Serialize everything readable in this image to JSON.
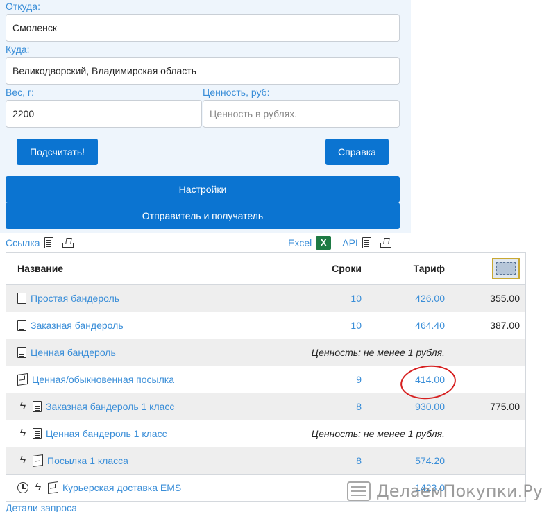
{
  "form": {
    "from_label": "Откуда:",
    "from_value": "Смоленск",
    "to_label": "Куда:",
    "to_value": "Великодворский, Владимирская область",
    "weight_label": "Вес, г:",
    "weight_value": "2200",
    "value_label": "Ценность, руб:",
    "value_placeholder": "Ценность в рублях.",
    "calc_button": "Подсчитать!",
    "help_button": "Справка",
    "settings_band": "Настройки",
    "sender_band": "Отправитель и получатель"
  },
  "toolbar": {
    "link_label": "Ссылка",
    "excel_label": "Excel",
    "excel_badge": "X",
    "api_label": "API"
  },
  "table": {
    "headers": {
      "name": "Название",
      "time": "Сроки",
      "tariff": "Тариф"
    },
    "rows": [
      {
        "name": "Простая бандероль",
        "time": "10",
        "tariff": "426.00",
        "extra": "355.00"
      },
      {
        "name": "Заказная бандероль",
        "time": "10",
        "tariff": "464.40",
        "extra": "387.00"
      },
      {
        "name": "Ценная бандероль",
        "note": "Ценность: не менее 1 рубля."
      },
      {
        "name": "Ценная/обыкновенная посылка",
        "time": "9",
        "tariff": "414.00"
      },
      {
        "name": "Заказная бандероль 1 класс",
        "time": "8",
        "tariff": "930.00",
        "extra": "775.00"
      },
      {
        "name": "Ценная бандероль 1 класс",
        "note": "Ценность: не менее 1 рубля."
      },
      {
        "name": "Посылка 1 класса",
        "time": "8",
        "tariff": "574.20"
      },
      {
        "name": "Курьерская доставка EMS",
        "tariff": "1423.0"
      }
    ]
  },
  "footer": {
    "details_link": "Детали запроса"
  },
  "watermark": {
    "text": "ДелаемПокупки.Ру"
  },
  "colors": {
    "accent": "#0b74d1",
    "link": "#3a8ed8",
    "panel": "#eef5fc",
    "annotation": "#d61f1f"
  }
}
